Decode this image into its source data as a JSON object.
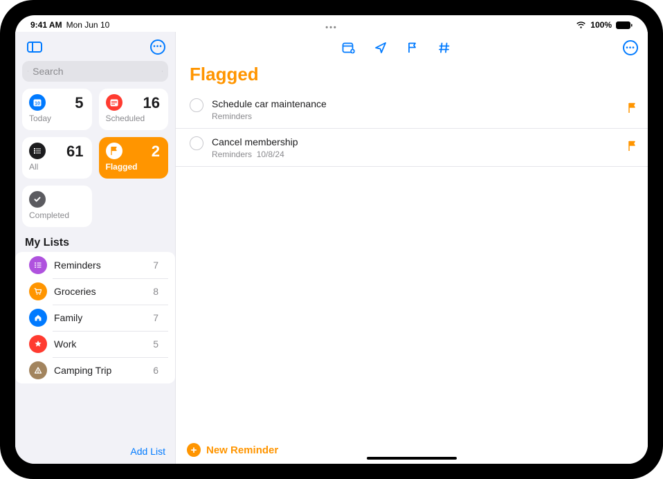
{
  "status": {
    "time": "9:41 AM",
    "date": "Mon Jun 10",
    "battery_pct": "100%"
  },
  "sidebar": {
    "search_placeholder": "Search",
    "cards": {
      "today": {
        "label": "Today",
        "count": "5",
        "color": "#007aff"
      },
      "scheduled": {
        "label": "Scheduled",
        "count": "16",
        "color": "#ff3b30"
      },
      "all": {
        "label": "All",
        "count": "61",
        "color": "#1c1c1e"
      },
      "flagged": {
        "label": "Flagged",
        "count": "2",
        "color": "#ff9500"
      },
      "completed": {
        "label": "Completed",
        "color": "#8e8e93"
      }
    },
    "mylists_header": "My Lists",
    "lists": [
      {
        "name": "Reminders",
        "count": "7",
        "color": "#af52de",
        "icon": "list-icon"
      },
      {
        "name": "Groceries",
        "count": "8",
        "color": "#ff9500",
        "icon": "cart-icon"
      },
      {
        "name": "Family",
        "count": "7",
        "color": "#007aff",
        "icon": "house-icon"
      },
      {
        "name": "Work",
        "count": "5",
        "color": "#ff3b30",
        "icon": "star-icon"
      },
      {
        "name": "Camping Trip",
        "count": "6",
        "color": "#a2845e",
        "icon": "tent-icon"
      }
    ],
    "add_list_label": "Add List"
  },
  "main": {
    "title": "Flagged",
    "reminders": [
      {
        "title": "Schedule car maintenance",
        "sublist": "Reminders",
        "date": ""
      },
      {
        "title": "Cancel membership",
        "sublist": "Reminders",
        "date": "10/8/24"
      }
    ],
    "new_reminder_label": "New Reminder"
  }
}
